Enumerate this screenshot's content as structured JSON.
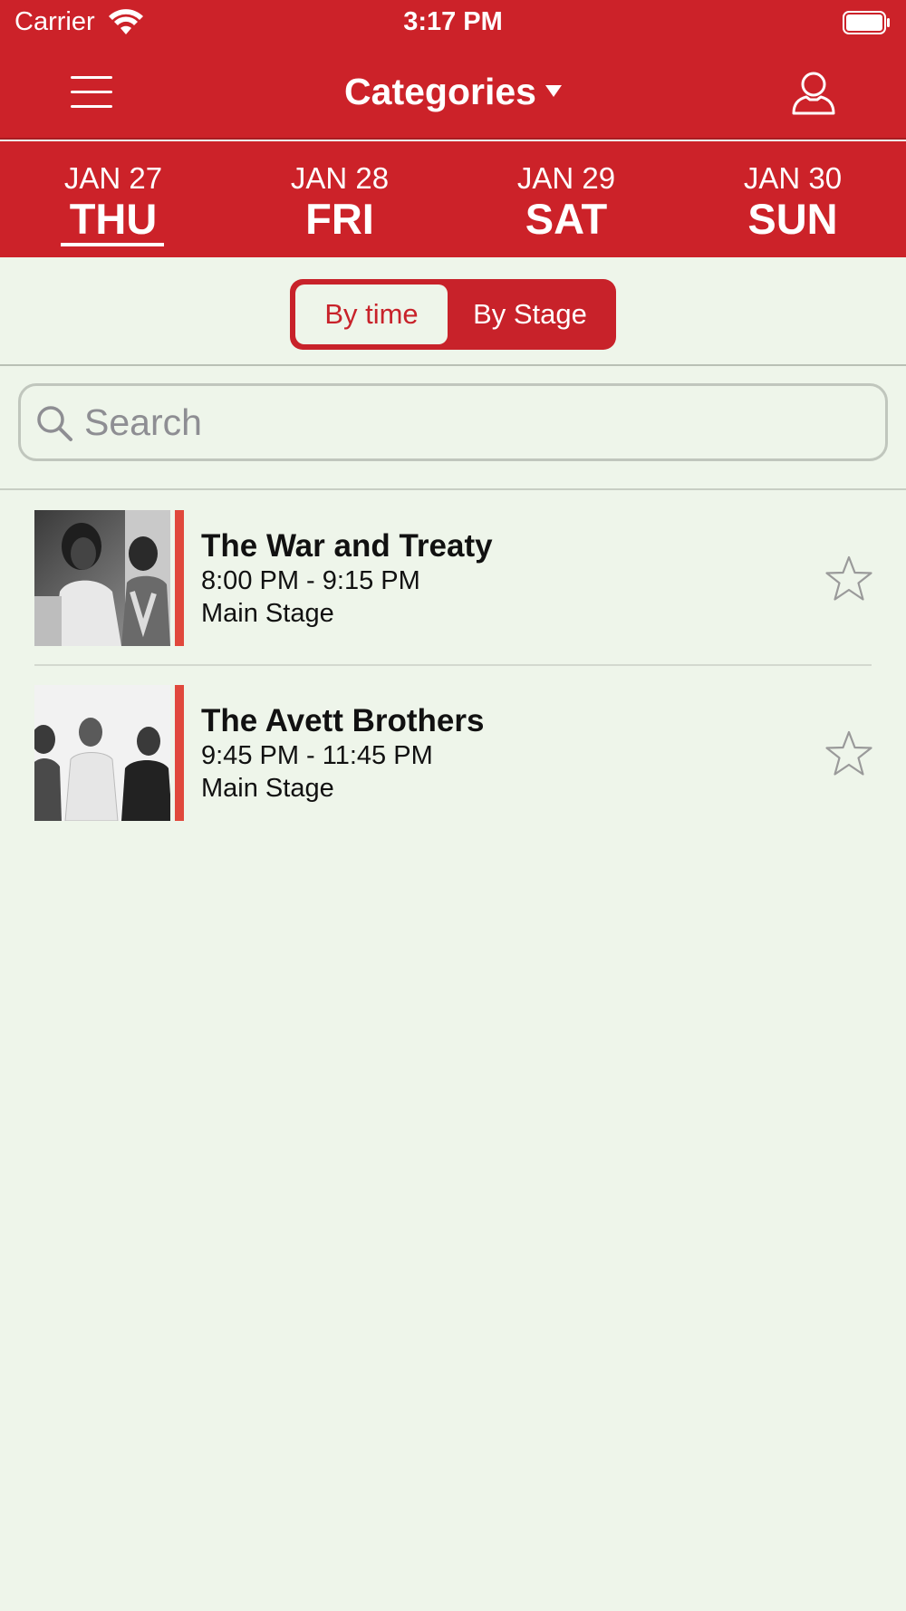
{
  "status_bar": {
    "carrier": "Carrier",
    "time": "3:17 PM"
  },
  "nav": {
    "title": "Categories",
    "menu_icon": "hamburger-menu-icon",
    "profile_icon": "user-profile-icon"
  },
  "days": [
    {
      "date": "JAN 27",
      "day": "THU",
      "selected": true
    },
    {
      "date": "JAN 28",
      "day": "FRI",
      "selected": false
    },
    {
      "date": "JAN 29",
      "day": "SAT",
      "selected": false
    },
    {
      "date": "JAN 30",
      "day": "SUN",
      "selected": false
    }
  ],
  "view_toggle": {
    "active": "By time",
    "inactive": "By Stage"
  },
  "search": {
    "placeholder": "Search",
    "value": ""
  },
  "events": [
    {
      "title": "The War and Treaty",
      "time": "8:00 PM - 9:15 PM",
      "stage": "Main Stage",
      "favorited": false
    },
    {
      "title": "The Avett Brothers",
      "time": "9:45 PM - 11:45 PM",
      "stage": "Main Stage",
      "favorited": false
    }
  ],
  "colors": {
    "primary": "#cc2229",
    "background": "#eef5ea",
    "accent_bar": "#e0483c",
    "star_outline": "#9a9a9a"
  }
}
